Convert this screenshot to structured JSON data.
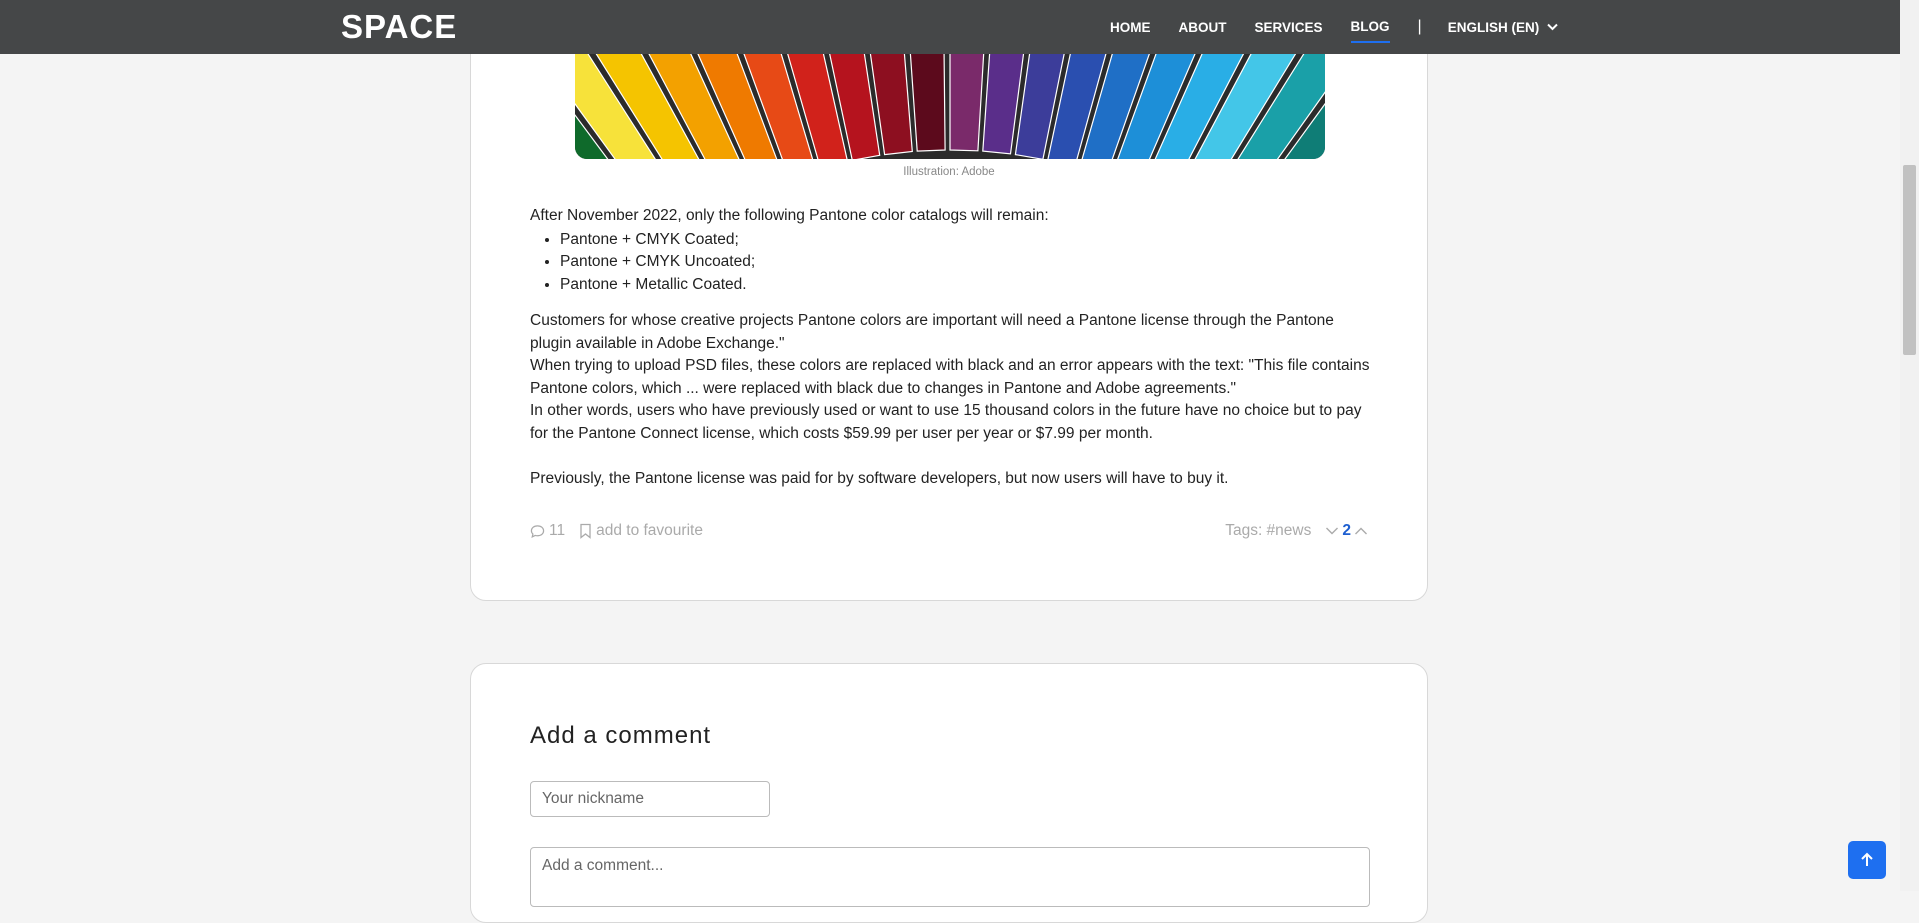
{
  "header": {
    "logo": "SPACE",
    "nav": [
      {
        "label": "HOME",
        "active": false
      },
      {
        "label": "ABOUT",
        "active": false
      },
      {
        "label": "SERVICES",
        "active": false
      },
      {
        "label": "BLOG",
        "active": true
      }
    ],
    "separator": "|",
    "language": "ENGLISH (EN)"
  },
  "post": {
    "image_caption": "Illustration: Adobe",
    "intro": "After November 2022, only the following Pantone color catalogs will remain:",
    "list": [
      "Pantone + CMYK Coated;",
      "Pantone + CMYK Uncoated;",
      "Pantone + Metallic Coated."
    ],
    "paragraph1": "Customers for whose creative projects Pantone colors are important will need a Pantone license through the Pantone plugin available in Adobe Exchange.\"",
    "paragraph2": "When trying to upload PSD files, these colors are replaced with black and an error appears with the text: \"This file contains Pantone colors, which ... were replaced with black due to changes in Pantone and Adobe agreements.\"",
    "paragraph3": "In other words, users who have previously used or want to use 15 thousand colors in the future have no choice but to pay for the Pantone Connect license, which costs $59.99 per user per year or $7.99 per month.",
    "paragraph4": "Previously, the Pantone license was paid for by software developers, but now users will have to buy it.",
    "comments_count": "11",
    "favourite_label": "add to favourite",
    "tags": "Tags: #news",
    "rating": "2"
  },
  "comment_form": {
    "title": "Add a comment",
    "nickname_placeholder": "Your nickname",
    "comment_placeholder": "Add a comment..."
  },
  "icons": {
    "comment": "speech-bubble-icon",
    "bookmark": "bookmark-icon",
    "vote_down": "chevron-down-icon",
    "vote_up": "chevron-up-icon",
    "language": "chevron-down-icon",
    "to_top": "arrow-up-icon"
  },
  "colors": {
    "header_bg": "#454748",
    "accent": "#1e6ff0",
    "page_bg": "#f4f4f4"
  }
}
